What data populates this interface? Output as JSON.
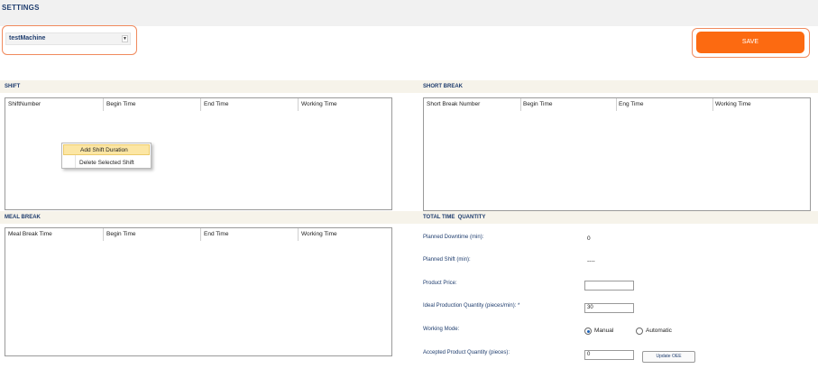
{
  "page": {
    "title": "SETTINGS"
  },
  "machine": {
    "selected": "testMachine"
  },
  "toolbar": {
    "save_label": "SAVE"
  },
  "shift": {
    "section_label": "SHIFT",
    "columns": [
      "ShiftNumber",
      "Begin Time",
      "End Time",
      "Working Time"
    ],
    "context_menu": [
      "Add Shift Duration",
      "Delete Selected Shift"
    ]
  },
  "short_break": {
    "section_label": "SHORT BREAK",
    "columns": [
      "Short Break Number",
      "Begin Time",
      "Eng Time",
      "Working Time"
    ]
  },
  "meal_break": {
    "section_label": "MEAL BREAK",
    "columns": [
      "Meal Break Time",
      "Begin Time",
      "End Time",
      "Working Time"
    ]
  },
  "total": {
    "section_label": "TOTAL TIME  QUANTITY",
    "planned_downtime_label": "Planned Downtime (min):",
    "planned_downtime_value": "0",
    "planned_shift_label": "Planned Shift (min):",
    "planned_shift_value": "----",
    "product_price_label": "Product Price:",
    "product_price_value": "",
    "ideal_qty_label": "Ideal Production Quantity (pieces/min): *",
    "ideal_qty_value": "30",
    "working_mode_label": "Working Mode:",
    "mode_manual": "Manual",
    "mode_automatic": "Automatic",
    "mode_selected": "Manual",
    "accepted_qty_label": "Accepted Product Quantity (pieces):",
    "accepted_qty_value": "0",
    "update_oee_label": "Update OEE"
  },
  "colors": {
    "accent": "#fc6a11",
    "heading": "#1f3d6e",
    "section_band": "#f6f3ea",
    "menu_highlight": "#fce6a4"
  }
}
